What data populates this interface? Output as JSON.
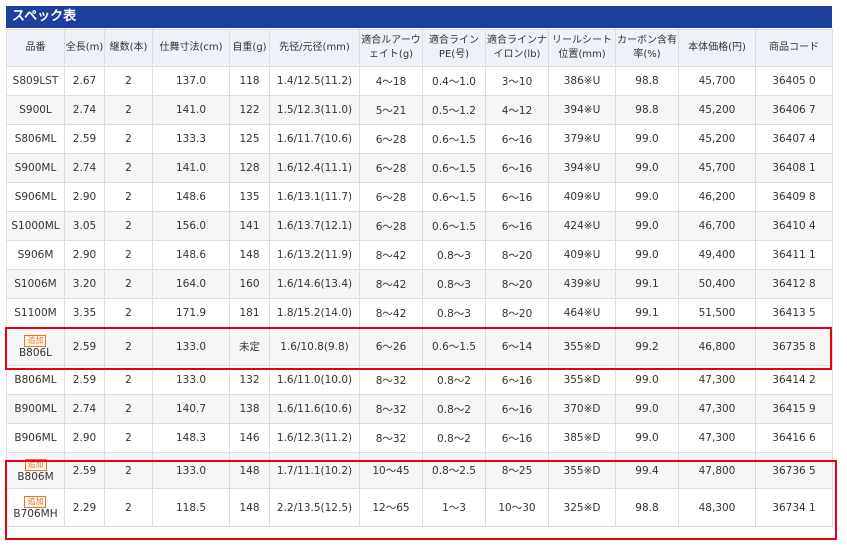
{
  "title": "スペック表",
  "badge_label": "追加",
  "colors": {
    "title_bg": "#1f3f9c",
    "highlight": "#e60012",
    "badge": "#e07a2a"
  },
  "headers": [
    "品番",
    "全長(m)",
    "継数(本)",
    "仕舞寸法(cm)",
    "自重(g)",
    "先径/元径(mm)",
    "適合ルアーウェイト(g)",
    "適合ラインPE(号)",
    "適合ラインナイロン(lb)",
    "リールシート位置(mm)",
    "カーボン含有率(%)",
    "本体価格(円)",
    "商品コード"
  ],
  "rows": [
    {
      "name": "S809LST",
      "new": false,
      "cells": [
        "2.67",
        "2",
        "137.0",
        "118",
        "1.4/12.5(11.2)",
        "4〜18",
        "0.4〜1.0",
        "3〜10",
        "386※U",
        "98.8",
        "45,700",
        "36405 0"
      ]
    },
    {
      "name": "S900L",
      "new": false,
      "cells": [
        "2.74",
        "2",
        "141.0",
        "122",
        "1.5/12.3(11.0)",
        "5〜21",
        "0.5〜1.2",
        "4〜12",
        "394※U",
        "98.8",
        "45,200",
        "36406 7"
      ]
    },
    {
      "name": "S806ML",
      "new": false,
      "cells": [
        "2.59",
        "2",
        "133.3",
        "125",
        "1.6/11.7(10.6)",
        "6〜28",
        "0.6〜1.5",
        "6〜16",
        "379※U",
        "99.0",
        "45,200",
        "36407 4"
      ]
    },
    {
      "name": "S900ML",
      "new": false,
      "cells": [
        "2.74",
        "2",
        "141.0",
        "128",
        "1.6/12.4(11.1)",
        "6〜28",
        "0.6〜1.5",
        "6〜16",
        "394※U",
        "99.0",
        "45,700",
        "36408 1"
      ]
    },
    {
      "name": "S906ML",
      "new": false,
      "cells": [
        "2.90",
        "2",
        "148.6",
        "135",
        "1.6/13.1(11.7)",
        "6〜28",
        "0.6〜1.5",
        "6〜16",
        "409※U",
        "99.0",
        "46,200",
        "36409 8"
      ]
    },
    {
      "name": "S1000ML",
      "new": false,
      "cells": [
        "3.05",
        "2",
        "156.0",
        "141",
        "1.6/13.7(12.1)",
        "6〜28",
        "0.6〜1.5",
        "6〜16",
        "424※U",
        "99.0",
        "46,700",
        "36410 4"
      ]
    },
    {
      "name": "S906M",
      "new": false,
      "cells": [
        "2.90",
        "2",
        "148.6",
        "148",
        "1.6/13.2(11.9)",
        "8〜42",
        "0.8〜3",
        "8〜20",
        "409※U",
        "99.0",
        "49,400",
        "36411 1"
      ]
    },
    {
      "name": "S1006M",
      "new": false,
      "cells": [
        "3.20",
        "2",
        "164.0",
        "160",
        "1.6/14.6(13.4)",
        "8〜42",
        "0.8〜3",
        "8〜20",
        "439※U",
        "99.1",
        "50,400",
        "36412 8"
      ]
    },
    {
      "name": "S1100M",
      "new": false,
      "cells": [
        "3.35",
        "2",
        "171.9",
        "181",
        "1.8/15.2(14.0)",
        "8〜42",
        "0.8〜3",
        "8〜20",
        "464※U",
        "99.1",
        "51,500",
        "36413 5"
      ]
    },
    {
      "name": "B806L",
      "new": true,
      "cells": [
        "2.59",
        "2",
        "133.0",
        "未定",
        "1.6/10.8(9.8)",
        "6〜26",
        "0.6〜1.5",
        "6〜14",
        "355※D",
        "99.2",
        "46,800",
        "36735 8"
      ]
    },
    {
      "name": "B806ML",
      "new": false,
      "cells": [
        "2.59",
        "2",
        "133.0",
        "132",
        "1.6/11.0(10.0)",
        "8〜32",
        "0.8〜2",
        "6〜16",
        "355※D",
        "99.0",
        "47,300",
        "36414 2"
      ]
    },
    {
      "name": "B900ML",
      "new": false,
      "cells": [
        "2.74",
        "2",
        "140.7",
        "138",
        "1.6/11.6(10.6)",
        "8〜32",
        "0.8〜2",
        "6〜16",
        "370※D",
        "99.0",
        "47,300",
        "36415 9"
      ]
    },
    {
      "name": "B906ML",
      "new": false,
      "cells": [
        "2.90",
        "2",
        "148.3",
        "146",
        "1.6/12.3(11.2)",
        "8〜32",
        "0.8〜2",
        "6〜16",
        "385※D",
        "99.0",
        "47,300",
        "36416 6"
      ]
    },
    {
      "name": "B806M",
      "new": true,
      "cells": [
        "2.59",
        "2",
        "133.0",
        "148",
        "1.7/11.1(10.2)",
        "10〜45",
        "0.8〜2.5",
        "8〜25",
        "355※D",
        "99.4",
        "47,800",
        "36736 5"
      ]
    },
    {
      "name": "B706MH",
      "new": true,
      "cells": [
        "2.29",
        "2",
        "118.5",
        "148",
        "2.2/13.5(12.5)",
        "12〜65",
        "1〜3",
        "10〜30",
        "325※D",
        "98.8",
        "48,300",
        "36734 1"
      ]
    }
  ]
}
